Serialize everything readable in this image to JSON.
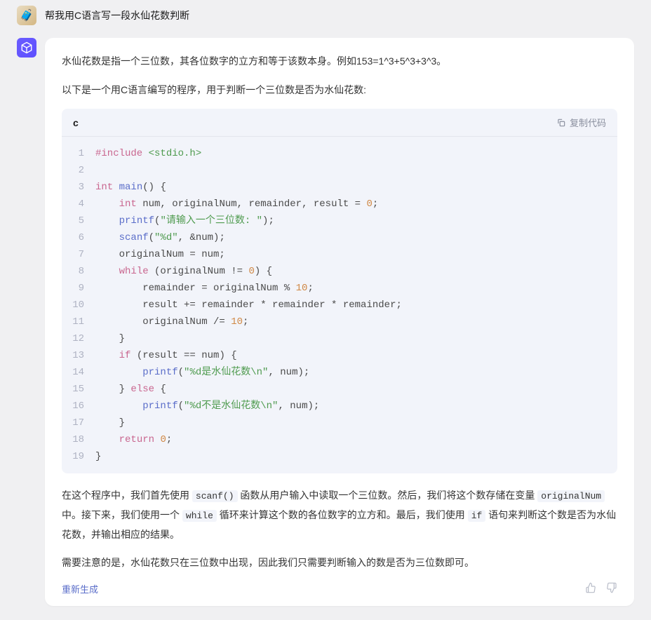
{
  "user": {
    "message": "帮我用C语言写一段水仙花数判断"
  },
  "assistant": {
    "para1": "水仙花数是指一个三位数，其各位数字的立方和等于该数本身。例如153=1^3+5^3+3^3。",
    "para2": "以下是一个用C语言编写的程序，用于判断一个三位数是否为水仙花数:",
    "code": {
      "lang": "c",
      "copy_label": "复制代码",
      "lines": [
        [
          {
            "t": "#include",
            "c": "inc"
          },
          {
            "t": " "
          },
          {
            "t": "<stdio.h>",
            "c": "hdr"
          }
        ],
        [],
        [
          {
            "t": "int",
            "c": "type"
          },
          {
            "t": " "
          },
          {
            "t": "main",
            "c": "fn"
          },
          {
            "t": "() {"
          }
        ],
        [
          {
            "t": "    "
          },
          {
            "t": "int",
            "c": "type"
          },
          {
            "t": " num, originalNum, remainder, result = "
          },
          {
            "t": "0",
            "c": "num"
          },
          {
            "t": ";"
          }
        ],
        [
          {
            "t": "    "
          },
          {
            "t": "printf",
            "c": "fn"
          },
          {
            "t": "("
          },
          {
            "t": "\"请输入一个三位数: \"",
            "c": "str"
          },
          {
            "t": ");"
          }
        ],
        [
          {
            "t": "    "
          },
          {
            "t": "scanf",
            "c": "fn"
          },
          {
            "t": "("
          },
          {
            "t": "\"%d\"",
            "c": "str"
          },
          {
            "t": ", &num);"
          }
        ],
        [
          {
            "t": "    originalNum = num;"
          }
        ],
        [
          {
            "t": "    "
          },
          {
            "t": "while",
            "c": "kw"
          },
          {
            "t": " (originalNum != "
          },
          {
            "t": "0",
            "c": "num"
          },
          {
            "t": ") {"
          }
        ],
        [
          {
            "t": "        remainder = originalNum % "
          },
          {
            "t": "10",
            "c": "num"
          },
          {
            "t": ";"
          }
        ],
        [
          {
            "t": "        result += remainder * remainder * remainder;"
          }
        ],
        [
          {
            "t": "        originalNum /= "
          },
          {
            "t": "10",
            "c": "num"
          },
          {
            "t": ";"
          }
        ],
        [
          {
            "t": "    }"
          }
        ],
        [
          {
            "t": "    "
          },
          {
            "t": "if",
            "c": "kw"
          },
          {
            "t": " (result == num) {"
          }
        ],
        [
          {
            "t": "        "
          },
          {
            "t": "printf",
            "c": "fn"
          },
          {
            "t": "("
          },
          {
            "t": "\"%d是水仙花数\\n\"",
            "c": "str"
          },
          {
            "t": ", num);"
          }
        ],
        [
          {
            "t": "    } "
          },
          {
            "t": "else",
            "c": "kw"
          },
          {
            "t": " {"
          }
        ],
        [
          {
            "t": "        "
          },
          {
            "t": "printf",
            "c": "fn"
          },
          {
            "t": "("
          },
          {
            "t": "\"%d不是水仙花数\\n\"",
            "c": "str"
          },
          {
            "t": ", num);"
          }
        ],
        [
          {
            "t": "    }"
          }
        ],
        [
          {
            "t": "    "
          },
          {
            "t": "return",
            "c": "kw"
          },
          {
            "t": " "
          },
          {
            "t": "0",
            "c": "num"
          },
          {
            "t": ";"
          }
        ],
        [
          {
            "t": "}"
          }
        ]
      ]
    },
    "para3_pre": "在这个程序中，我们首先使用 ",
    "para3_code1": "scanf()",
    "para3_mid1": " 函数从用户输入中读取一个三位数。然后，我们将这个数存储在变量 ",
    "para3_code2": "originalNum",
    "para3_mid2": " 中。接下来，我们使用一个 ",
    "para3_code3": "while",
    "para3_mid3": " 循环来计算这个数的各位数字的立方和。最后，我们使用 ",
    "para3_code4": "if",
    "para3_end": " 语句来判断这个数是否为水仙花数，并输出相应的结果。",
    "para4": "需要注意的是，水仙花数只在三位数中出现，因此我们只需要判断输入的数是否为三位数即可。"
  },
  "footer": {
    "regenerate": "重新生成"
  }
}
